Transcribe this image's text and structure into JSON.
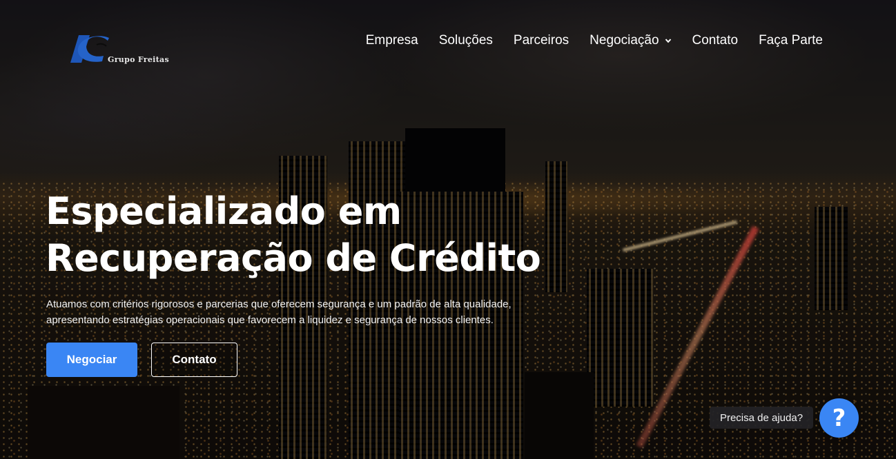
{
  "brand": {
    "name": "Grupo Freitas",
    "logo_color": "#1e56b8"
  },
  "nav": {
    "items": [
      {
        "label": "Empresa"
      },
      {
        "label": "Soluções"
      },
      {
        "label": "Parceiros"
      },
      {
        "label": "Negociação",
        "icon": "chevron-down-icon"
      },
      {
        "label": "Contato"
      },
      {
        "label": "Faça Parte"
      }
    ]
  },
  "hero": {
    "title_line1": "Especializado em",
    "title_line2": "Recuperação de Crédito",
    "subtitle_line1": "Atuamos com critérios rigorosos e parcerias que oferecem segurança e um padrão de alta qualidade,",
    "subtitle_line2": "apresentando estratégias operacionais que favorecem a liquidez e segurança de nossos clientes.",
    "primary_button": "Negociar",
    "secondary_button": "Contato"
  },
  "help": {
    "label": "Precisa de ajuda?",
    "icon_glyph": "?",
    "icon": "question-mark-icon"
  },
  "colors": {
    "accent": "#3a86f4"
  }
}
